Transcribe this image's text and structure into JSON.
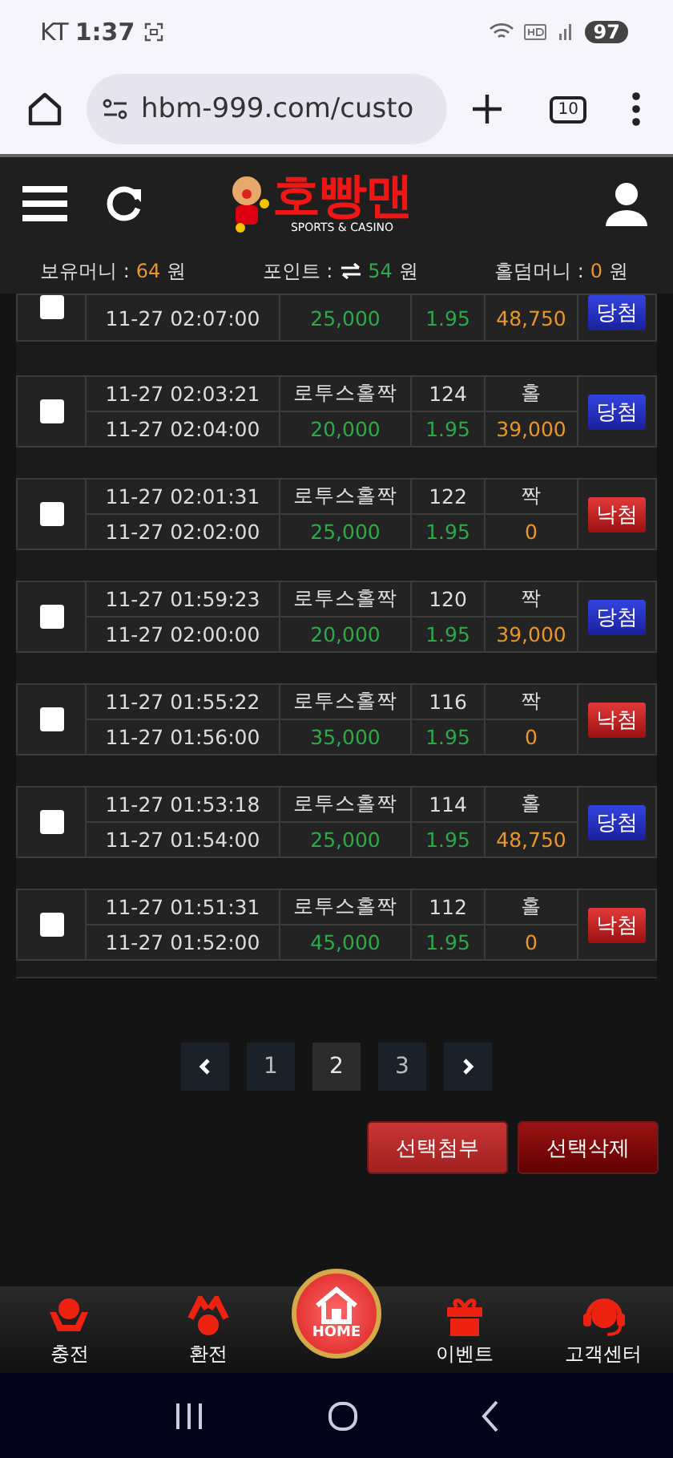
{
  "status_bar": {
    "carrier": "KT",
    "time": "1:37",
    "battery": "97"
  },
  "browser": {
    "url": "hbm-999.com/custo",
    "tab_count": "10"
  },
  "header": {
    "logo": "호빵맨",
    "tagline": "SPORTS & CASINO"
  },
  "balances": [
    {
      "label": "보유머니 :",
      "value": "64",
      "unit": "원",
      "kind": "plain"
    },
    {
      "label": "포인트 :",
      "value": "54",
      "unit": "원",
      "kind": "transfer"
    },
    {
      "label": "홀덤머니 :",
      "value": "0",
      "unit": "원",
      "kind": "plain"
    }
  ],
  "bets": [
    {
      "checked": false,
      "settle_time": "11-27 02:07:00",
      "amount": "25,000",
      "odds": "1.95",
      "payout": "48,750",
      "result": {
        "label": "당첨",
        "kind": "win"
      }
    },
    {
      "checked": false,
      "bet_time": "11-27 02:03:21",
      "game": "로투스홀짝",
      "round": "124",
      "pick": "홀",
      "settle_time": "11-27 02:04:00",
      "amount": "20,000",
      "odds": "1.95",
      "payout": "39,000",
      "result": {
        "label": "당첨",
        "kind": "win"
      }
    },
    {
      "checked": false,
      "bet_time": "11-27 02:01:31",
      "game": "로투스홀짝",
      "round": "122",
      "pick": "짝",
      "settle_time": "11-27 02:02:00",
      "amount": "25,000",
      "odds": "1.95",
      "payout": "0",
      "result": {
        "label": "낙첨",
        "kind": "lose"
      }
    },
    {
      "checked": false,
      "bet_time": "11-27 01:59:23",
      "game": "로투스홀짝",
      "round": "120",
      "pick": "짝",
      "settle_time": "11-27 02:00:00",
      "amount": "20,000",
      "odds": "1.95",
      "payout": "39,000",
      "result": {
        "label": "당첨",
        "kind": "win"
      }
    },
    {
      "checked": false,
      "bet_time": "11-27 01:55:22",
      "game": "로투스홀짝",
      "round": "116",
      "pick": "짝",
      "settle_time": "11-27 01:56:00",
      "amount": "35,000",
      "odds": "1.95",
      "payout": "0",
      "result": {
        "label": "낙첨",
        "kind": "lose"
      }
    },
    {
      "checked": false,
      "bet_time": "11-27 01:53:18",
      "game": "로투스홀짝",
      "round": "114",
      "pick": "홀",
      "settle_time": "11-27 01:54:00",
      "amount": "25,000",
      "odds": "1.95",
      "payout": "48,750",
      "result": {
        "label": "당첨",
        "kind": "win"
      }
    },
    {
      "checked": false,
      "bet_time": "11-27 01:51:31",
      "game": "로투스홀짝",
      "round": "112",
      "pick": "홀",
      "settle_time": "11-27 01:52:00",
      "amount": "45,000",
      "odds": "1.95",
      "payout": "0",
      "result": {
        "label": "낙첨",
        "kind": "lose"
      }
    }
  ],
  "pagination": {
    "pages": [
      {
        "label": "1",
        "selected": false
      },
      {
        "label": "2",
        "selected": true
      },
      {
        "label": "3",
        "selected": false
      }
    ]
  },
  "actions": [
    {
      "label": "선택첨부",
      "kind": "attach"
    },
    {
      "label": "선택삭제",
      "kind": "delete"
    }
  ],
  "bottom_nav": [
    {
      "label": "충전",
      "kind": "deposit"
    },
    {
      "label": "환전",
      "kind": "withdraw"
    },
    {
      "label": "HOME",
      "kind": "home"
    },
    {
      "label": "이벤트",
      "kind": "gift"
    },
    {
      "label": "고객센터",
      "kind": "support"
    }
  ]
}
